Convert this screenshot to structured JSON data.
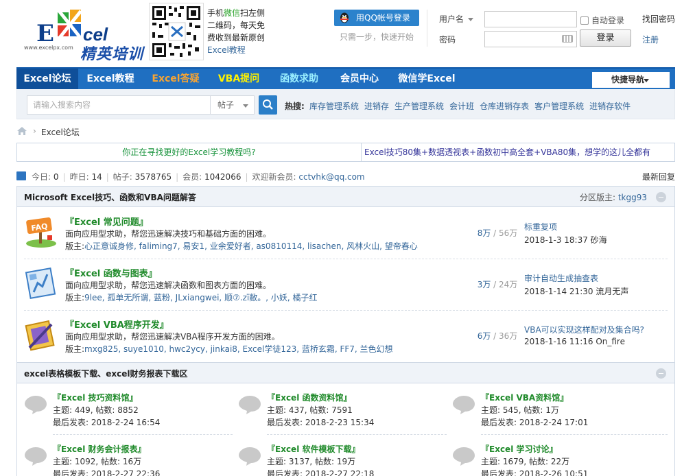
{
  "header": {
    "logo_url_text": "www.excelpx.com",
    "logo_word_e": "E",
    "logo_word_cel": "cel",
    "logo_subtitle": "精英培训",
    "qr_line1_a": "手机",
    "qr_line1_b": "微信",
    "qr_line1_c": "扫左侧",
    "qr_line2": "二维码，每天免",
    "qr_line3": "费收到最新原创",
    "qr_line4": "Excel教程",
    "qq_login_label": "用QQ帐号登录",
    "qq_hint": "只需一步，快速开始",
    "username_label": "用户名",
    "password_label": "密码",
    "auto_login_label": "自动登录",
    "login_button": "登录",
    "find_password": "找回密码",
    "register": "注册"
  },
  "nav": {
    "items": [
      {
        "label": "Excel论坛"
      },
      {
        "label": "Excel教程"
      },
      {
        "label": "Excel答疑"
      },
      {
        "label": "VBA提问"
      },
      {
        "label": "函数求助"
      },
      {
        "label": "会员中心"
      },
      {
        "label": "微信学Excel"
      }
    ],
    "quick_nav": "快捷导航"
  },
  "search": {
    "placeholder": "请输入搜索内容",
    "scope": "帖子",
    "hot_label": "热搜:",
    "hot_terms": [
      "库存管理系统",
      "进销存",
      "生产管理系统",
      "会计班",
      "仓库进销存表",
      "客户管理系统",
      "进销存软件"
    ]
  },
  "breadcrumb": {
    "sep": "›",
    "current": "Excel论坛"
  },
  "promo": {
    "left": "你正在寻找更好的Excel学习教程吗?",
    "right": "Excel技巧80集+数据透视表+函数初中高全套+VBA80集，想学的这儿全都有"
  },
  "stats": {
    "today_label": "今日:",
    "today": "0",
    "yesterday_label": "昨日:",
    "yesterday": "14",
    "posts_label": "帖子:",
    "posts": "3578765",
    "members_label": "会员:",
    "members": "1042066",
    "welcome_label": "欢迎新会员:",
    "newest_member": "cctvhk@qq.com",
    "latest_replies": "最新回复"
  },
  "section1": {
    "title": "Microsoft Excel技巧、函数和VBA问题解答",
    "mod_label": "分区版主:",
    "mod_name": "tkgg93",
    "forums": [
      {
        "name": "『Excel 常见问题』",
        "desc": "面向应用型求助，帮您迅速解决技巧和基础方面的困难。",
        "mods_label": "版主:",
        "mods": "心正意诚身修, faliming7, 易安1, 业余爱好者, as0810114, lisachen, 风林火山, 望帝春心",
        "threads": "8万",
        "posts": "56万",
        "last_title": "标重复项",
        "last_meta": "2018-1-3 18:37 砂海"
      },
      {
        "name": "『Excel 函数与图表』",
        "desc": "面向应用型求助，帮您迅速解决函数和图表方面的困难。",
        "mods_label": "版主:",
        "mods": "9lee, 孤单无所谓, 蓝粉, JLxiangwei, 顺⑦.zï敝。, 小妖, 橘子红",
        "threads": "3万",
        "posts": "24万",
        "last_title": "审计自动生成抽查表",
        "last_meta": "2018-1-14 21:30 流月无声"
      },
      {
        "name": "『Excel VBA程序开发』",
        "desc": "面向应用型求助，帮您迅速解决VBA程序开发方面的困难。",
        "mods_label": "版主:",
        "mods": "mxg825, suye1010, hwc2ycy, jinkai8, Excel学徒123, 蓝桥玄霜, FF7, 兰色幻想",
        "threads": "6万",
        "posts": "36万",
        "last_title": "VBA可以实现这样配对及集合吗?",
        "last_meta": "2018-1-16 11:16 On_fire"
      }
    ]
  },
  "section2": {
    "title": "excel表格模板下载、excel财务报表下载区",
    "tiles": [
      {
        "name": "『Excel 技巧资料馆』",
        "stat": "主题: 449, 帖数: 8852",
        "last": "最后发表: 2018-2-24 16:54"
      },
      {
        "name": "『Excel 函数资料馆』",
        "stat": "主题: 437, 帖数: 7591",
        "last": "最后发表: 2018-2-23 15:34"
      },
      {
        "name": "『Excel VBA资料馆』",
        "stat": "主题: 545, 帖数: 1万",
        "last": "最后发表: 2018-2-24 17:01"
      },
      {
        "name": "『Excel 财务会计报表』",
        "stat": "主题: 1092, 帖数: 16万",
        "last": "最后发表: 2018-2-27 22:36"
      },
      {
        "name": "『Excel 软件模板下载』",
        "stat": "主题: 3137, 帖数: 19万",
        "last": "最后发表: 2018-2-27 22:18"
      },
      {
        "name": "『Excel 学习讨论』",
        "stat": "主题: 1679, 帖数: 22万",
        "last": "最后发表: 2018-2-26 10:51"
      }
    ]
  }
}
